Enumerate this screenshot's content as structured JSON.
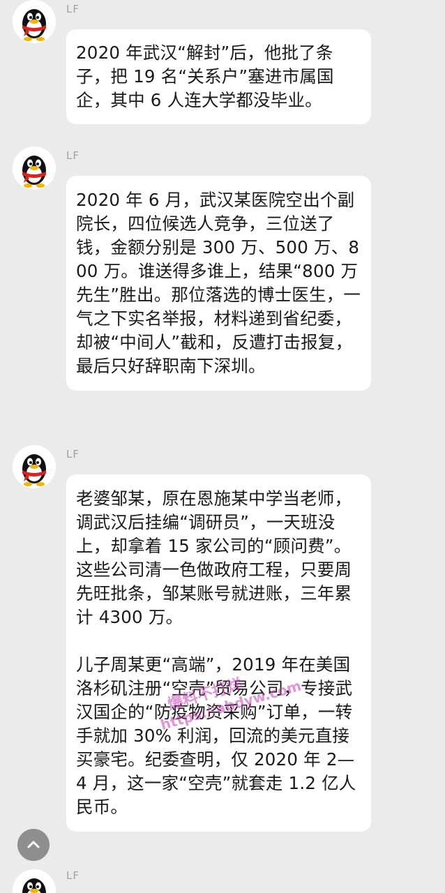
{
  "chat": {
    "messages": [
      {
        "sender": "LF",
        "paragraphs": [
          "2020 年武汉“解封”后，他批了条子，把 19 名“关系户”塞进市属国企，其中 6 人连大学都没毕业。"
        ]
      },
      {
        "sender": "LF",
        "paragraphs": [
          "2020 年 6 月，武汉某医院空出个副院长，四位候选人竞争，三位送了钱，金额分别是 300 万、500 万、800 万。谁送得多谁上，结果“800 万先生”胜出。那位落选的博士医生，一气之下实名举报，材料递到省纪委，却被“中间人”截和，反遭打击报复，最后只好辞职南下深圳。"
        ]
      },
      {
        "sender": "LF",
        "paragraphs": [
          " 老婆邹某，原在恩施某中学当老师，调武汉后挂编“调研员”，一天班没上，却拿着 15 家公司的“顾问费”。这些公司清一色做政府工程，只要周先旺批条，邹某账号就进账，三年累计 4300 万。",
          "儿子周某更“高端”，2019 年在美国洛杉矶注册“空壳”贸易公司，专接武汉国企的“防疫物资采购”订单，一转手就加 30% 利润，回流的美元直接买豪宅。纪委查明，仅 2020 年 2—4 月，这一家“空壳”就套走 1.2 亿人民币。"
        ]
      },
      {
        "sender": "LF",
        "paragraphs": []
      }
    ]
  },
  "watermark": {
    "line1": "爆料不打烊",
    "line2": "https://abdyw.com"
  },
  "scroll_top_button": {
    "icon": "chevron-up-icon"
  },
  "colors": {
    "background": "#ebebeb",
    "bubble": "#ffffff",
    "text": "#1a1a1a",
    "sender": "#a0a0a0",
    "avatar_red": "#d8231f"
  }
}
